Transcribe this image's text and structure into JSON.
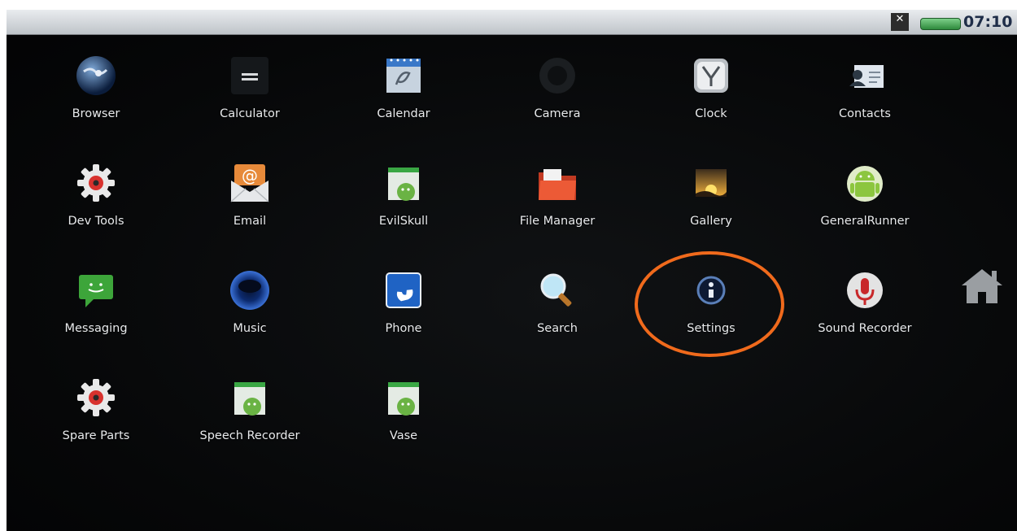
{
  "status_bar": {
    "time": "07:10",
    "close_glyph": "✕"
  },
  "apps": [
    {
      "label": "Browser",
      "icon": "globe-icon"
    },
    {
      "label": "Calculator",
      "icon": "calculator-icon"
    },
    {
      "label": "Calendar",
      "icon": "calendar-icon"
    },
    {
      "label": "Camera",
      "icon": "camera-icon"
    },
    {
      "label": "Clock",
      "icon": "clock-icon"
    },
    {
      "label": "Contacts",
      "icon": "contacts-icon"
    },
    {
      "label": "Dev Tools",
      "icon": "gear-icon"
    },
    {
      "label": "Email",
      "icon": "envelope-icon"
    },
    {
      "label": "EvilSkull",
      "icon": "android-app-icon"
    },
    {
      "label": "File Manager",
      "icon": "folder-icon"
    },
    {
      "label": "Gallery",
      "icon": "gallery-icon"
    },
    {
      "label": "GeneralRunner",
      "icon": "android-robot-icon"
    },
    {
      "label": "Messaging",
      "icon": "message-icon"
    },
    {
      "label": "Music",
      "icon": "music-icon"
    },
    {
      "label": "Phone",
      "icon": "phone-icon"
    },
    {
      "label": "Search",
      "icon": "magnifier-icon"
    },
    {
      "label": "Settings",
      "icon": "settings-icon"
    },
    {
      "label": "Sound Recorder",
      "icon": "microphone-icon"
    },
    {
      "label": "Spare Parts",
      "icon": "gear-icon"
    },
    {
      "label": "Speech Recorder",
      "icon": "android-app-icon"
    },
    {
      "label": "Vase",
      "icon": "android-app-icon"
    }
  ],
  "highlighted_app": "Settings",
  "colors": {
    "highlight_ring": "#f06a1c",
    "background": "#060708",
    "label": "#e8eaec"
  }
}
